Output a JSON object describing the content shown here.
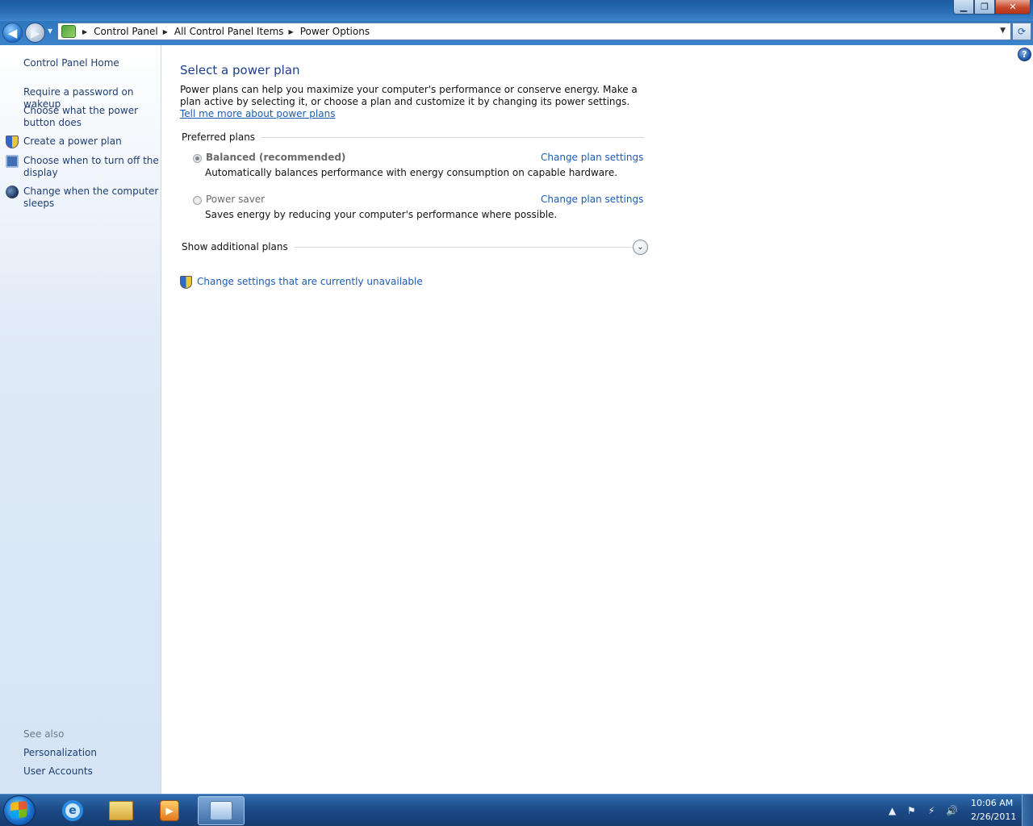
{
  "window": {
    "controls": {
      "minimize": "▁",
      "maximize": "❐",
      "close": "✕"
    }
  },
  "address_bar": {
    "crumbs": [
      "Control Panel",
      "All Control Panel Items",
      "Power Options"
    ],
    "separator": "▶",
    "dropdown": "▼",
    "refresh": "⟳",
    "back": "◀",
    "forward": "▶",
    "recent": "▼"
  },
  "left_pane": {
    "home": "Control Panel Home",
    "links": [
      "Require a password on wakeup",
      "Choose what the power button does",
      "Create a power plan",
      "Choose when to turn off the display",
      "Change when the computer sleeps"
    ],
    "see_also_label": "See also",
    "see_also": [
      "Personalization",
      "User Accounts"
    ]
  },
  "main": {
    "help": "?",
    "title": "Select a power plan",
    "intro_text": "Power plans can help you maximize your computer's performance or conserve energy. Make a plan active by selecting it, or choose a plan and customize it by changing its power settings. ",
    "intro_link": "Tell me more about power plans",
    "preferred_label": "Preferred plans",
    "plans": [
      {
        "name": "Balanced (recommended)",
        "description": "Automatically balances performance with energy consumption on capable hardware.",
        "change_link": "Change plan settings",
        "selected": true
      },
      {
        "name": "Power saver",
        "description": "Saves energy by reducing your computer's performance where possible.",
        "change_link": "Change plan settings",
        "selected": false
      }
    ],
    "additional_label": "Show additional plans",
    "expand_glyph": "⌄",
    "unavailable_link": "Change settings that are currently unavailable"
  },
  "taskbar": {
    "ie_letter": "e",
    "media_glyph": "▶",
    "tray_icons": [
      "▲",
      "⚑",
      "⚡",
      "🔊"
    ],
    "time": "10:06 AM",
    "date": "2/26/2011"
  }
}
